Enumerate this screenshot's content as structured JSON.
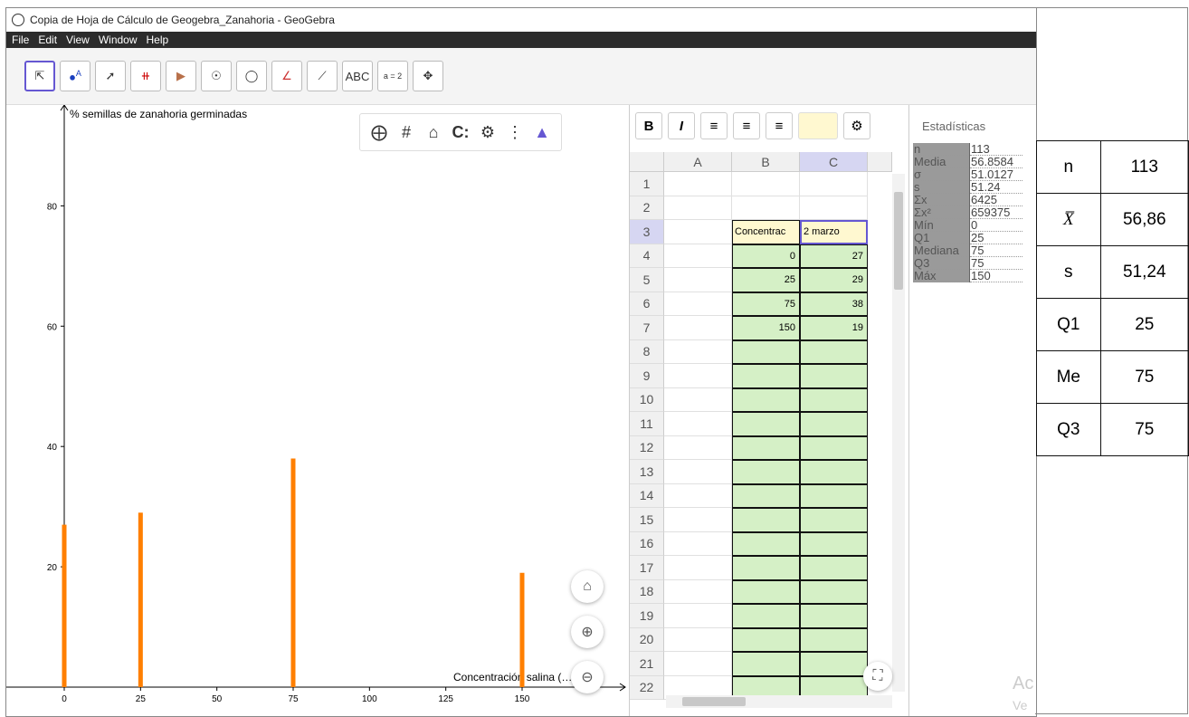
{
  "window": {
    "title": "Copia de Hoja de Cálculo de Geogebra_Zanahoria - GeoGebra"
  },
  "menu": [
    "File",
    "Edit",
    "View",
    "Window",
    "Help"
  ],
  "toolbar": {
    "text_tool": "ABC",
    "slider_tool": "a = 2"
  },
  "graphics": {
    "y_axis_label": "% semillas de zanahoria germinadas",
    "x_axis_label": "Concentración salina (… l)",
    "x_ticks": [
      "0",
      "25",
      "50",
      "75",
      "100",
      "125",
      "150"
    ],
    "y_ticks": [
      "80",
      "60",
      "40",
      "20"
    ],
    "bar_color": "#ff7f00"
  },
  "chart_data": {
    "type": "bar",
    "x": [
      0,
      25,
      75,
      150
    ],
    "values": [
      27,
      29,
      38,
      19
    ],
    "xlabel": "Concentración salina (… l)",
    "ylabel": "% semillas de zanahoria germinadas",
    "xlim": [
      -18,
      165
    ],
    "ylim": [
      0,
      93
    ]
  },
  "spreadsheet": {
    "columns": [
      "A",
      "B",
      "C"
    ],
    "rows": [
      "1",
      "2",
      "3",
      "4",
      "5",
      "6",
      "7",
      "8",
      "9",
      "10",
      "11",
      "12",
      "13",
      "14",
      "15",
      "16",
      "17",
      "18",
      "19",
      "20",
      "21",
      "22"
    ],
    "B3": "Concentrac",
    "C3": "2 marzo",
    "data": [
      {
        "b": "0",
        "c": "27"
      },
      {
        "b": "25",
        "c": "29"
      },
      {
        "b": "75",
        "c": "38"
      },
      {
        "b": "150",
        "c": "19"
      }
    ]
  },
  "statistics": {
    "title": "Estadísticas",
    "rows": [
      {
        "k": "n",
        "v": "113"
      },
      {
        "k": "Media",
        "v": "56.8584"
      },
      {
        "k": "σ",
        "v": "51.0127"
      },
      {
        "k": "s",
        "v": "51.24"
      },
      {
        "k": "Σx",
        "v": "6425"
      },
      {
        "k": "Σx²",
        "v": "659375"
      },
      {
        "k": "Mín",
        "v": "0"
      },
      {
        "k": "Q1",
        "v": "25"
      },
      {
        "k": "Mediana",
        "v": "75"
      },
      {
        "k": "Q3",
        "v": "75"
      },
      {
        "k": "Máx",
        "v": "150"
      }
    ]
  },
  "summary_table": [
    {
      "label": "n",
      "value": "113"
    },
    {
      "label": "X̅",
      "value": "56,86"
    },
    {
      "label": "s",
      "value": "51,24"
    },
    {
      "label": "Q1",
      "value": "25"
    },
    {
      "label": "Me",
      "value": "75"
    },
    {
      "label": "Q3",
      "value": "75"
    }
  ],
  "watermark": [
    "Ac",
    "Ve"
  ]
}
